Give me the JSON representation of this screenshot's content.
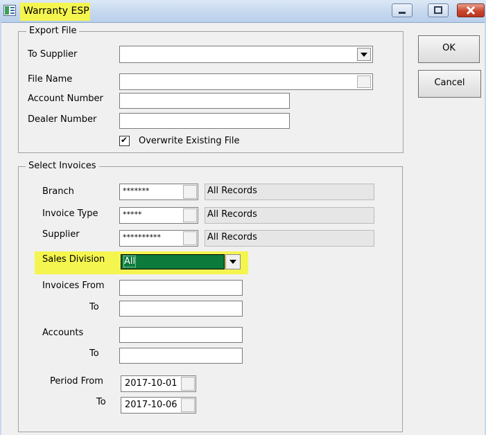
{
  "window": {
    "title": "Warranty ESP"
  },
  "export_file": {
    "legend": "Export File",
    "to_supplier_label": "To Supplier",
    "to_supplier_value": "",
    "file_name_label": "File Name",
    "file_name_value": "",
    "account_number_label": "Account Number",
    "account_number_value": "",
    "dealer_number_label": "Dealer Number",
    "dealer_number_value": "",
    "overwrite_label": "Overwrite Existing File",
    "overwrite_checked": true,
    "checkmark": "✔"
  },
  "buttons": {
    "ok": "OK",
    "cancel": "Cancel"
  },
  "select_invoices": {
    "legend": "Select Invoices",
    "branch_label": "Branch",
    "branch_code": "*******",
    "branch_desc": "All Records",
    "invoice_type_label": "Invoice Type",
    "invoice_type_code": "*****",
    "invoice_type_desc": "All Records",
    "supplier_label": "Supplier",
    "supplier_code": "**********",
    "supplier_desc": "All Records",
    "sales_division_label": "Sales Division",
    "sales_division_value": "All",
    "invoices_from_label": "Invoices  From",
    "invoices_to_label": "To",
    "accounts_label": "Accounts",
    "accounts_to_label": "To",
    "period_from_label": "Period   From",
    "period_from_value": "2017-10-01",
    "period_to_label": "To",
    "period_to_value": "2017-10-06"
  },
  "colors": {
    "highlight": "#f5f550",
    "selection": "#0b7a3a"
  },
  "icons": [
    "app-icon",
    "minimize-icon",
    "maximize-icon",
    "close-icon",
    "dropdown-arrow-icon",
    "check-icon"
  ]
}
